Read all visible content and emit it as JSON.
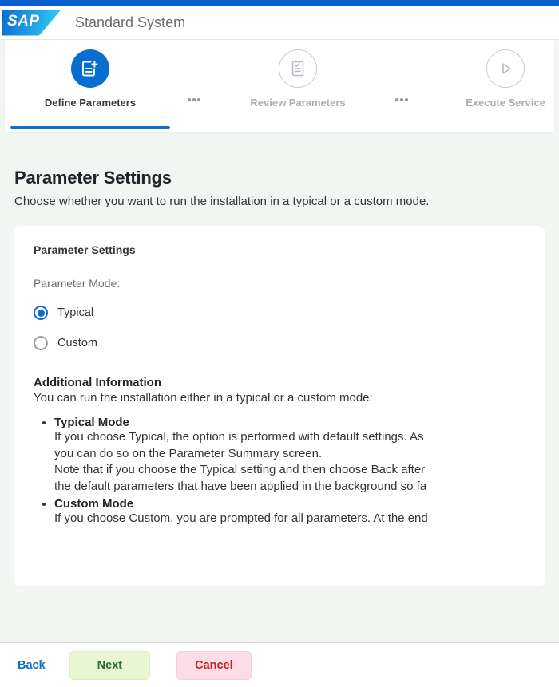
{
  "shell": {
    "logo_text": "SAP",
    "title": "Standard System",
    "accent_color": "#0a5fd0"
  },
  "wizard": {
    "separator_icon": "three-dots-icon",
    "steps": [
      {
        "label": "Define Parameters",
        "icon": "document-add-icon",
        "state": "active"
      },
      {
        "label": "Review Parameters",
        "icon": "checklist-icon",
        "state": "inactive"
      },
      {
        "label": "Execute Service",
        "icon": "play-icon",
        "state": "inactive"
      }
    ]
  },
  "page": {
    "title": "Parameter Settings",
    "subtitle": "Choose whether you want to run the installation in a typical or a custom mode."
  },
  "card": {
    "section_title": "Parameter Settings",
    "field_label": "Parameter Mode:",
    "options": [
      {
        "label": "Typical",
        "selected": true
      },
      {
        "label": "Custom",
        "selected": false
      }
    ],
    "additional": {
      "heading": "Additional Information",
      "intro": "You can run the installation either in a typical or a custom mode:",
      "modes": [
        {
          "name": "Typical Mode",
          "lines": [
            "If you choose Typical, the option is performed with default settings. As",
            "you can do so on the Parameter Summary screen.",
            "Note that if you choose the Typical setting and then choose Back after",
            "the default parameters that have been applied in the background so fa"
          ]
        },
        {
          "name": "Custom Mode",
          "lines": [
            "If you choose Custom, you are prompted for all parameters. At the end"
          ]
        }
      ]
    }
  },
  "footer": {
    "back_label": "Back",
    "next_label": "Next",
    "cancel_label": "Cancel"
  }
}
